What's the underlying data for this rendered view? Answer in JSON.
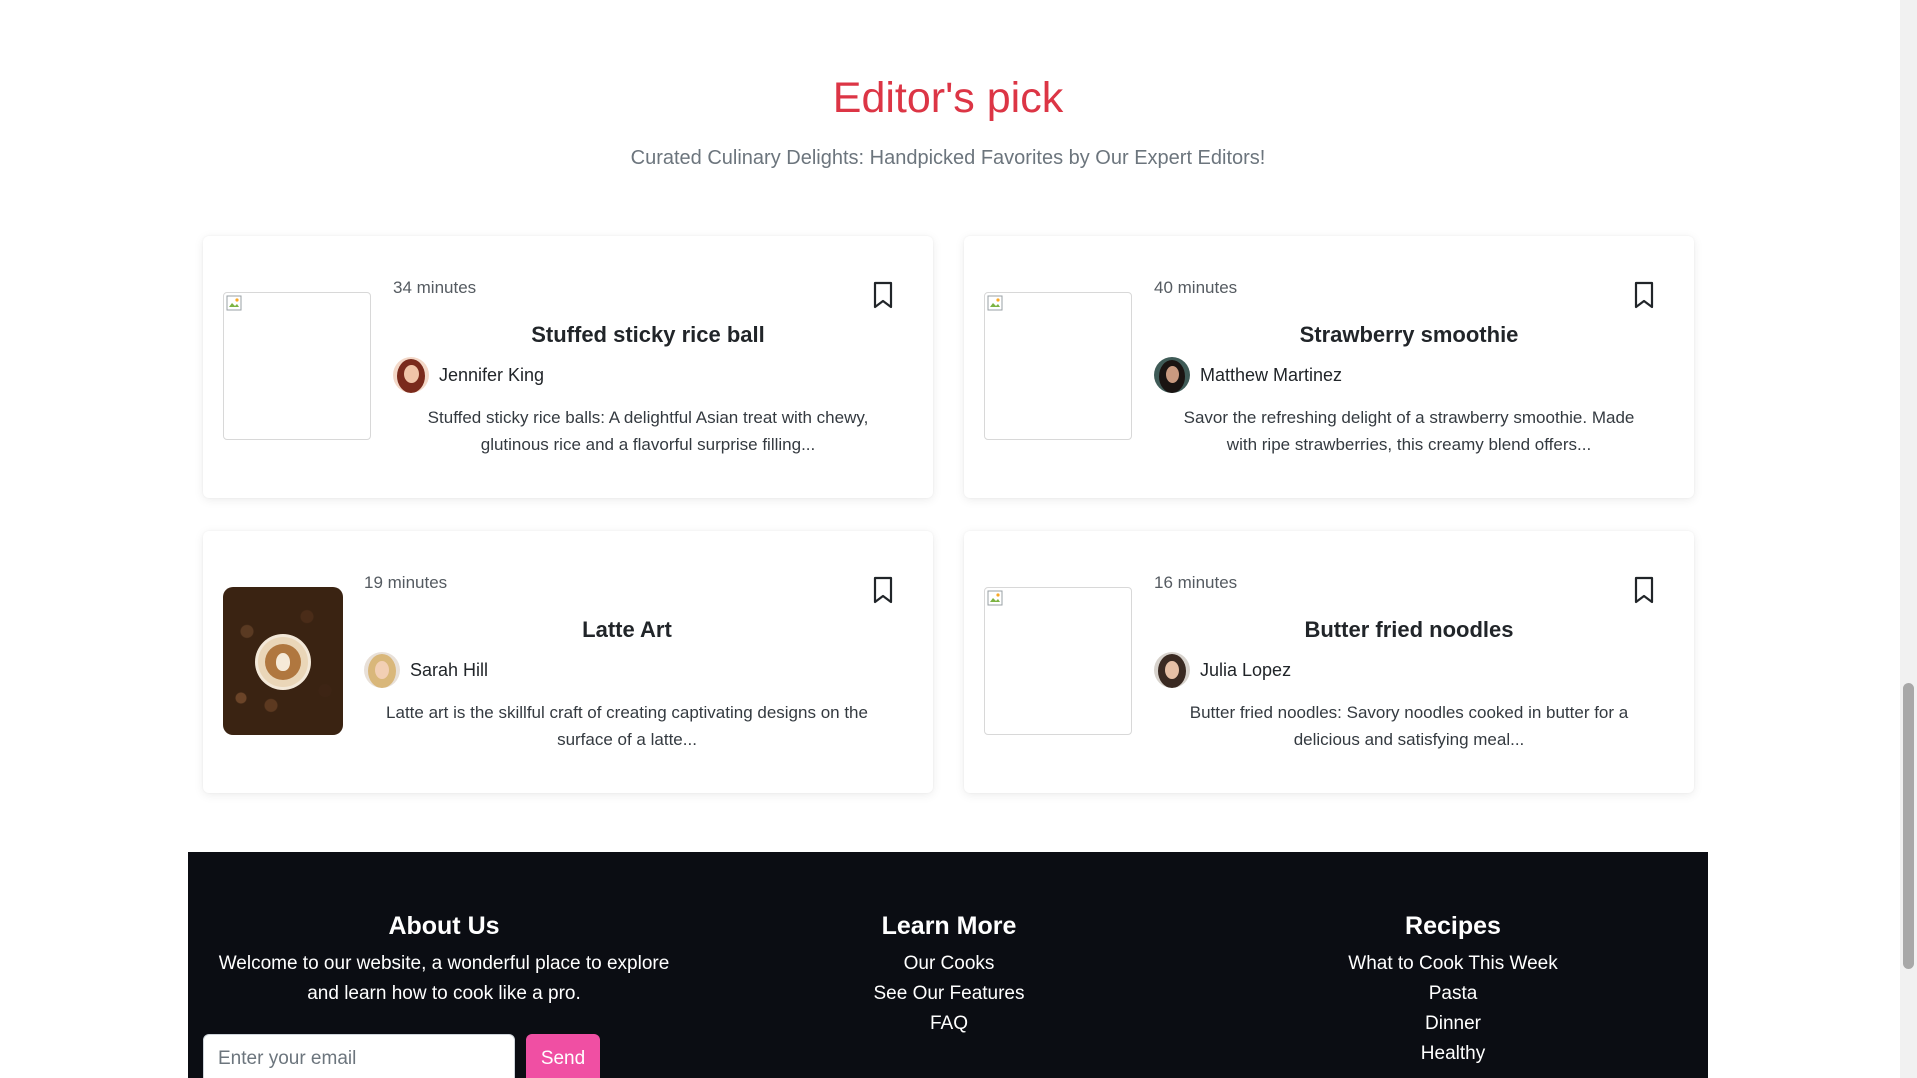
{
  "section": {
    "title": "Editor's pick",
    "subtitle": "Curated Culinary Delights: Handpicked Favorites by Our Expert Editors!"
  },
  "recipes": [
    {
      "minutes": "34 minutes",
      "title": "Stuffed sticky rice ball",
      "author": "Jennifer King",
      "description_line1": "Stuffed sticky rice balls: A delightful Asian treat with chewy,",
      "description_line2": "glutinous rice and a flavorful surprise filling..."
    },
    {
      "minutes": "40 minutes",
      "title": "Strawberry smoothie",
      "author": "Matthew Martinez",
      "description_line1": "Savor the refreshing delight of a strawberry smoothie. Made",
      "description_line2": "with ripe strawberries, this creamy blend offers..."
    },
    {
      "minutes": "19 minutes",
      "title": "Latte Art",
      "author": "Sarah Hill",
      "description_line1": "Latte art is the skillful craft of creating captivating designs on the",
      "description_line2": "surface of a latte..."
    },
    {
      "minutes": "16 minutes",
      "title": "Butter fried noodles",
      "author": "Julia Lopez",
      "description_line1": "Butter fried noodles: Savory noodles cooked in butter for a",
      "description_line2": "delicious and satisfying meal..."
    }
  ],
  "footer": {
    "about": {
      "heading": "About Us",
      "text_line1": "Welcome to our website, a wonderful place to explore",
      "text_line2": "and learn how to cook like a pro.",
      "email_placeholder": "Enter your email",
      "send_label": "Send"
    },
    "learn_more": {
      "heading": "Learn More",
      "links": [
        "Our Cooks",
        "See Our Features",
        "FAQ"
      ]
    },
    "recipes": {
      "heading": "Recipes",
      "links": [
        "What to Cook This Week",
        "Pasta",
        "Dinner",
        "Healthy"
      ]
    }
  },
  "colors": {
    "accent": "#dc3545",
    "footer_bg": "#0b0d13",
    "send_button": "#f04fa3"
  }
}
